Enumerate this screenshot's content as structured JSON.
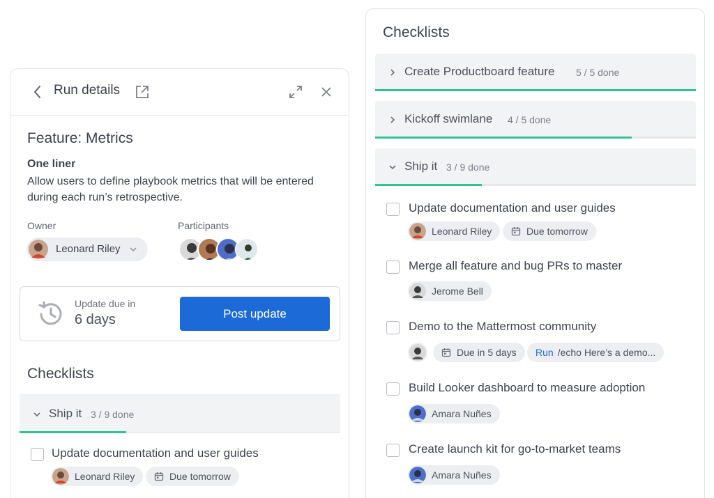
{
  "run_details": {
    "title": "Run details",
    "feature_title": "Feature: Metrics",
    "one_liner_label": "One liner",
    "one_liner_text": "Allow users to define playbook metrics that will be entered during each run’s retrospective.",
    "owner_label": "Owner",
    "owner_name": "Leonard Riley",
    "participants_label": "Participants",
    "update_label": "Update due in",
    "update_value": "6 days",
    "post_update_label": "Post update",
    "checklists_title": "Checklists",
    "section": {
      "name": "Ship it",
      "progress": "3 / 9 done",
      "fraction": 0.333
    },
    "item": {
      "text": "Update documentation and user guides",
      "assignee": "Leonard Riley",
      "due": "Due tomorrow"
    }
  },
  "checklists_panel": {
    "title": "Checklists",
    "sections": [
      {
        "name": "Create Productboard feature",
        "progress": "5 / 5 done",
        "fraction": 1.0,
        "expanded": false
      },
      {
        "name": "Kickoff swimlane",
        "progress": "4 / 5 done",
        "fraction": 0.8,
        "expanded": false
      },
      {
        "name": "Ship it",
        "progress": "3 / 9 done",
        "fraction": 0.333,
        "expanded": true
      }
    ],
    "items": [
      {
        "text": "Update documentation and user guides",
        "assignee": "Leonard Riley",
        "due": "Due tomorrow"
      },
      {
        "text": "Merge all feature and bug PRs to master",
        "assignee": "Jerome Bell"
      },
      {
        "text": "Demo to the Mattermost community",
        "due": "Due in 5 days",
        "run_label": "Run",
        "command": "/echo Here’s a demo..."
      },
      {
        "text": "Build Looker dashboard to measure adoption",
        "assignee": "Amara Nuñes"
      },
      {
        "text": "Create launch kit for go-to-market teams",
        "assignee": "Amara Nuñes"
      }
    ]
  },
  "colors": {
    "accent": "#1c6ad8",
    "progress": "#30c48f",
    "chip_bg": "#eceef1"
  }
}
